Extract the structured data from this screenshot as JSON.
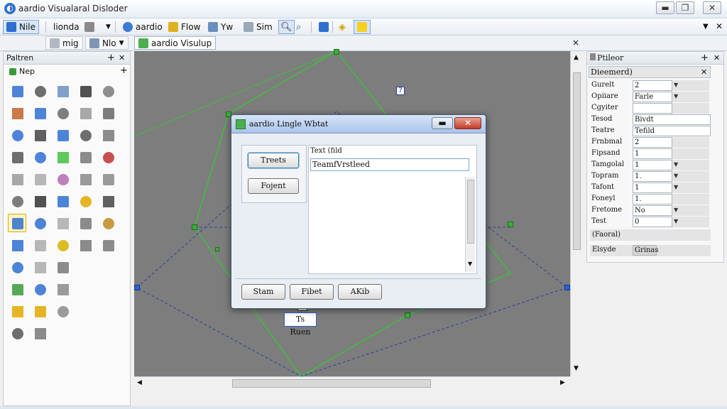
{
  "window": {
    "title": "aardio Visualaral Disloder",
    "min": "▬",
    "max": "❐",
    "close": "✕"
  },
  "toolbar": {
    "file": "Nile",
    "layout": "lionda",
    "radio": "aardio",
    "flow": "Flow",
    "view": "Yw",
    "sim": "Sim"
  },
  "tabrow": {
    "mig": "mig",
    "nlo": "Nlo",
    "doc_tab": "aardio Visulup",
    "close": "×",
    "pin": "▾"
  },
  "left": {
    "title": "Paltren",
    "pin": "+",
    "close": "✕",
    "sub": "Nep",
    "sub_add": "+"
  },
  "dialog": {
    "title": "aardio Lingle Wbtat",
    "btn_treets": "Treets",
    "btn_fojent": "Fojent",
    "text_label": "Text (fild",
    "text_value": "TeamfVrstleed",
    "btn_stam": "Stam",
    "btn_fibet": "Fibet",
    "btn_akib": "AKib"
  },
  "canvas": {
    "node_label": "Ts Ruen",
    "node_mark": "7"
  },
  "right": {
    "title": "Ptileor",
    "pin": "+",
    "close": "✕",
    "object": "Dieemerd)",
    "rows": [
      {
        "name": "Gurelt",
        "value": "2",
        "dd": true
      },
      {
        "name": "Opiiare",
        "value": "Farle",
        "dd": true
      },
      {
        "name": "Cgyiter",
        "value": "",
        "dd": false
      },
      {
        "name": "Tesod",
        "value": "Bivdt",
        "dd": false,
        "wide": true
      },
      {
        "name": "Teatre",
        "value": "Tefild",
        "dd": false,
        "wide": true
      },
      {
        "name": "Frnbmal",
        "value": "2",
        "dd": false
      },
      {
        "name": "Fipsand",
        "value": "1",
        "dd": false
      },
      {
        "name": "Tamgolal",
        "value": "1",
        "dd": true
      },
      {
        "name": "Topram",
        "value": "1.",
        "dd": true
      },
      {
        "name": "Tafont",
        "value": "1",
        "dd": true
      },
      {
        "name": "Foneyl",
        "value": "1.",
        "dd": false
      },
      {
        "name": "Fretome",
        "value": "No",
        "dd": true
      },
      {
        "name": "Test",
        "value": "0",
        "dd": true
      }
    ],
    "section": "(Faoral)",
    "footer_name": "Elsyde",
    "footer_value": "Grinas"
  },
  "colors": {
    "canvas": "#7d7d7d",
    "guide_green": "#3fbf3f",
    "guide_blue": "#2244aa",
    "accent": "#2f6fd0"
  }
}
